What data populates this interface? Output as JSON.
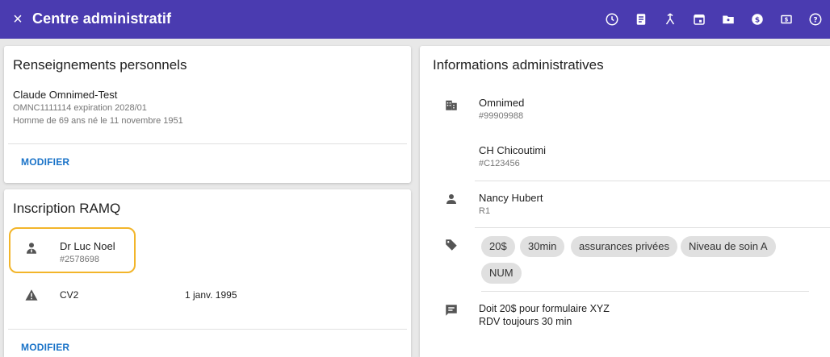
{
  "header": {
    "title": "Centre administratif",
    "close_icon": "×",
    "tools": [
      "clock-icon",
      "document-list-icon",
      "merge-icon",
      "calendar-icon",
      "folder-icon",
      "dollar-circle-icon",
      "billing-icon",
      "help-icon"
    ]
  },
  "personal": {
    "title": "Renseignements personnels",
    "patient_name": "Claude Omnimed-Test",
    "ramq_line": "OMNC1111114 expiration 2028/01",
    "details_line": "Homme de 69 ans né le 11 novembre 1951",
    "edit_label": "MODIFIER"
  },
  "ramq": {
    "title": "Inscription RAMQ",
    "doctor_name": "Dr Luc Noel",
    "doctor_id": "#2578698",
    "alert_code": "CV2",
    "alert_date": "1 janv. 1995",
    "edit_label": "MODIFIER"
  },
  "admin": {
    "title": "Informations administratives",
    "org_name": "Omnimed",
    "org_id": "#99909988",
    "site_name": "CH Chicoutimi",
    "site_id": "#C123456",
    "person_name": "Nancy Hubert",
    "person_role": "R1",
    "tags": [
      "20$",
      "30min",
      "assurances privées",
      "Niveau de soin A",
      "NUM"
    ],
    "note_line1": "Doit 20$ pour formulaire XYZ",
    "note_line2": "RDV toujours 30 min"
  },
  "colors": {
    "header_bg": "#4a3bb0",
    "accent_link": "#1a73c8",
    "highlight": "#f2b52a"
  }
}
